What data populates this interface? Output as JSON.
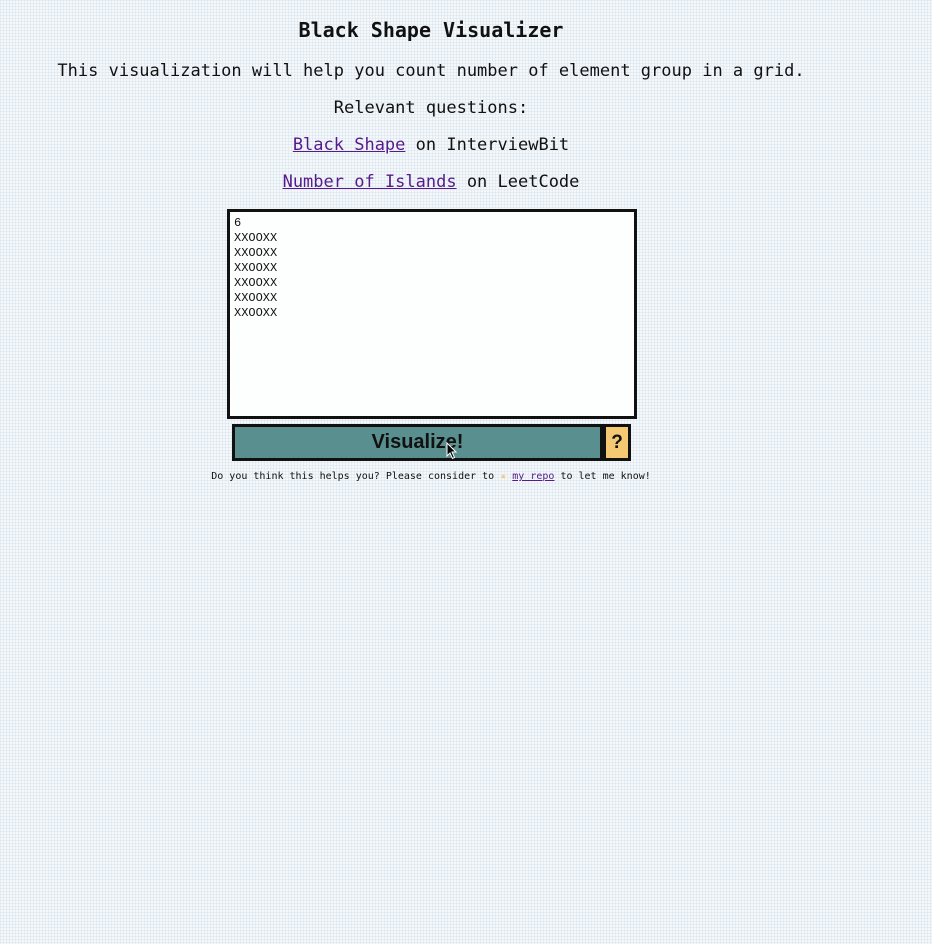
{
  "title": "Black Shape Visualizer",
  "intro": "This visualization will help you count number of element group in a grid.",
  "relevant_heading": "Relevant questions:",
  "questions": [
    {
      "link": "Black Shape",
      "suffix": " on InterviewBit"
    },
    {
      "link": "Number of Islands",
      "suffix": " on LeetCode"
    }
  ],
  "grid_input": "6\nXXOOXX\nXXOOXX\nXXOOXX\nXXOOXX\nXXOOXX\nXXOOXX",
  "buttons": {
    "visualize": "Visualize!",
    "help": "?"
  },
  "footer": {
    "before": "Do you think this helps you? Please consider to ",
    "star": "★",
    "link": "my repo",
    "after": " to let me know!"
  },
  "colors": {
    "visualize_bg": "#5a8f8f",
    "help_bg": "#f5c873",
    "link": "#551a8b"
  },
  "icons": {
    "star": "star-icon",
    "cursor": "mouse-pointer-icon"
  }
}
